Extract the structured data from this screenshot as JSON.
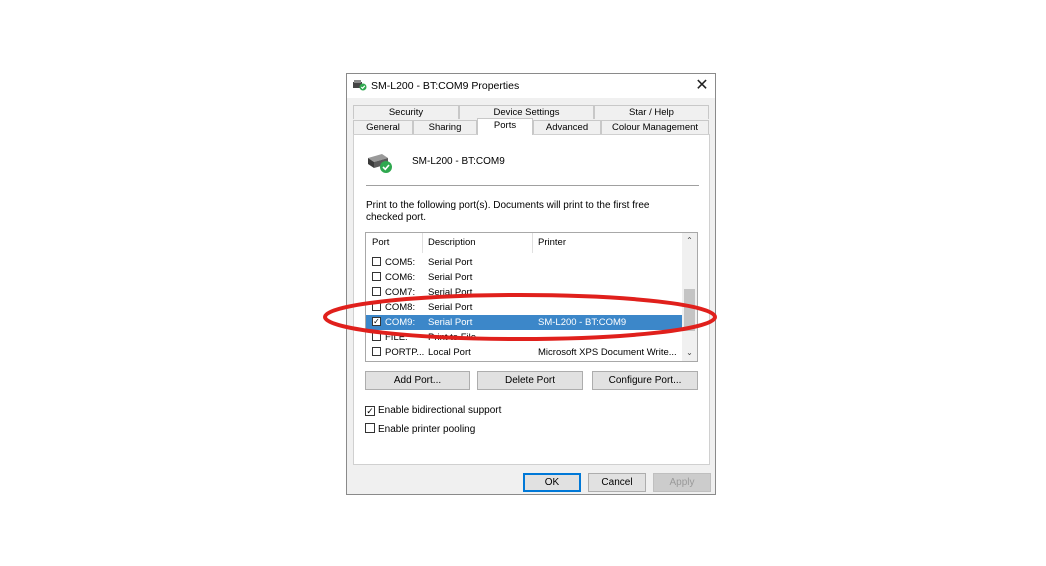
{
  "window": {
    "title": "SM-L200 - BT:COM9 Properties",
    "close_glyph": "✕"
  },
  "tabs": {
    "row_top": [
      "Security",
      "Device Settings",
      "Star / Help"
    ],
    "row_bottom": [
      "General",
      "Sharing",
      "Ports",
      "Advanced",
      "Colour Management"
    ],
    "active": "Ports"
  },
  "printer": {
    "name": "SM-L200 - BT:COM9",
    "icon": "printer-check-icon"
  },
  "instructions": {
    "line1": "Print to the following port(s). Documents will print to the first free",
    "line2": "checked port."
  },
  "port_list": {
    "columns": [
      "Port",
      "Description",
      "Printer"
    ],
    "rows": [
      {
        "port": "COM5:",
        "description": "Serial Port",
        "printer": "",
        "checked": false
      },
      {
        "port": "COM6:",
        "description": "Serial Port",
        "printer": "",
        "checked": false
      },
      {
        "port": "COM7:",
        "description": "Serial Port",
        "printer": "",
        "checked": false
      },
      {
        "port": "COM8:",
        "description": "Serial Port",
        "printer": "",
        "checked": false
      },
      {
        "port": "COM9:",
        "description": "Serial Port",
        "printer": "SM-L200 - BT:COM9",
        "checked": true,
        "selected": true
      },
      {
        "port": "FILE:",
        "description": "Print to File",
        "printer": "",
        "checked": false
      },
      {
        "port": "PORTP...",
        "description": "Local Port",
        "printer": "Microsoft XPS Document Write...",
        "checked": false
      }
    ]
  },
  "buttons": {
    "add_port": "Add Port...",
    "delete_port": "Delete Port",
    "configure_port": "Configure Port...",
    "ok": "OK",
    "cancel": "Cancel",
    "apply": "Apply"
  },
  "options": {
    "bidirectional": {
      "label": "Enable bidirectional support",
      "checked": true
    },
    "pooling": {
      "label": "Enable printer pooling",
      "checked": false
    }
  },
  "colors": {
    "selection": "#3c87c9",
    "highlight_ellipse": "#e0201c",
    "ok_border": "#0078d7"
  }
}
